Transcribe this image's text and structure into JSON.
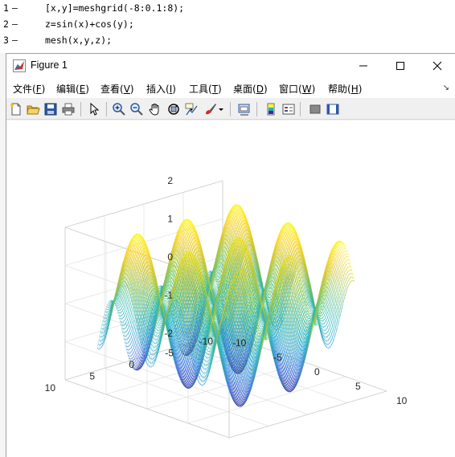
{
  "editor": {
    "lines": [
      {
        "num": "1",
        "marker": "–",
        "code": "[x,y]=meshgrid(-8:0.1:8);"
      },
      {
        "num": "2",
        "marker": "–",
        "code": "z=sin(x)+cos(y);"
      },
      {
        "num": "3",
        "marker": "–",
        "code": "mesh(x,y,z);"
      }
    ]
  },
  "window": {
    "title": "Figure 1",
    "controls": [
      "minimize-icon",
      "maximize-icon",
      "close-icon"
    ]
  },
  "menu": {
    "items": [
      {
        "label": "文件(",
        "key": "F",
        "end": ")"
      },
      {
        "label": "编辑(",
        "key": "E",
        "end": ")"
      },
      {
        "label": "查看(",
        "key": "V",
        "end": ")"
      },
      {
        "label": "插入(",
        "key": "I",
        "end": ")"
      },
      {
        "label": "工具(",
        "key": "T",
        "end": ")"
      },
      {
        "label": "桌面(",
        "key": "D",
        "end": ")"
      },
      {
        "label": "窗口(",
        "key": "W",
        "end": ")"
      },
      {
        "label": "帮助(",
        "key": "H",
        "end": ")"
      }
    ],
    "overflow_icon": "dock-arrow-icon"
  },
  "toolbar": {
    "tools": [
      "new-figure-icon",
      "open-file-icon",
      "save-icon",
      "print-icon",
      "edit-plot-arrow-icon",
      "zoom-in-icon",
      "zoom-out-icon",
      "pan-hand-icon",
      "rotate-3d-icon",
      "data-cursor-icon",
      "brush-icon",
      "dropdown-arrow-icon",
      "link-plot-icon",
      "colorbar-icon",
      "legend-icon",
      "hide-plot-tools-icon",
      "show-plot-tools-icon"
    ]
  },
  "chart_data": {
    "type": "mesh-surface",
    "function": "z = sin(x) + cos(y)",
    "x_range": [
      -8,
      8
    ],
    "y_range": [
      -8,
      8
    ],
    "step": 0.1,
    "zlim": [
      -2,
      2
    ],
    "z_ticks": [
      "2",
      "1",
      "0",
      "-1",
      "-2"
    ],
    "x_ticks": [
      "-10",
      "-5",
      "0",
      "5",
      "10"
    ],
    "y_ticks": [
      "10",
      "5",
      "0",
      "-5",
      "-10"
    ],
    "colormap": "parula",
    "colors": {
      "low": "#3e26a8",
      "mid": "#21b2a6",
      "high": "#f9fb15"
    },
    "grid": true
  }
}
